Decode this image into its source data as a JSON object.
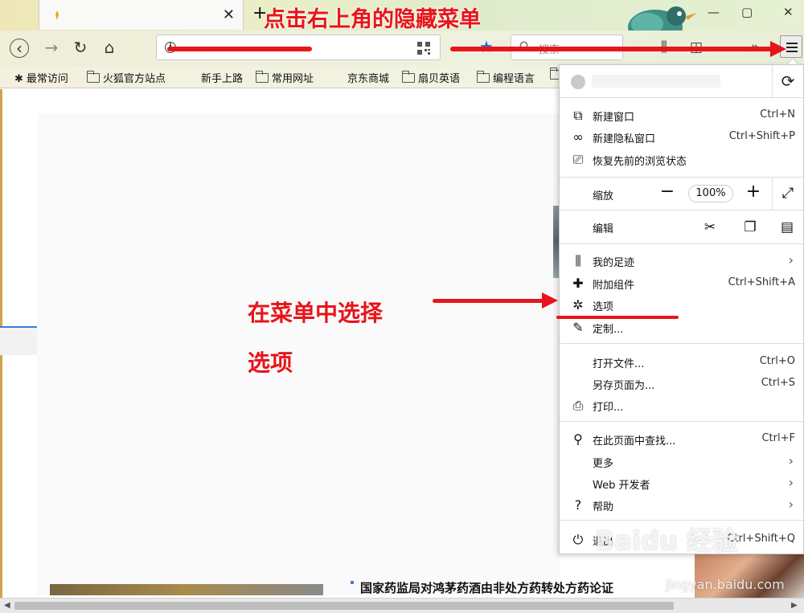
{
  "bookmarks": [
    {
      "label": "最常访问",
      "icon": "star-icon"
    },
    {
      "label": "火狐官方站点",
      "icon": "folder-icon"
    },
    {
      "label": "新手上路",
      "icon": "folder-icon"
    },
    {
      "label": "常用网址",
      "icon": "folder-icon"
    },
    {
      "label": "京东商城",
      "icon": "folder-icon"
    },
    {
      "label": "扇贝英语",
      "icon": "folder-icon"
    },
    {
      "label": "编程语言",
      "icon": "folder-icon"
    }
  ],
  "search": {
    "placeholder": "搜索"
  },
  "menu": {
    "new_window": {
      "label": "新建窗口",
      "shortcut": "Ctrl+N"
    },
    "private_window": {
      "label": "新建隐私窗口",
      "shortcut": "Ctrl+Shift+P"
    },
    "restore_session": {
      "label": "恢复先前的浏览状态"
    },
    "zoom": {
      "label": "缩放",
      "value": "100%"
    },
    "edit": {
      "label": "编辑"
    },
    "library": {
      "label": "我的足迹"
    },
    "addons": {
      "label": "附加组件",
      "shortcut": "Ctrl+Shift+A"
    },
    "options": {
      "label": "选项"
    },
    "customize": {
      "label": "定制..."
    },
    "open_file": {
      "label": "打开文件...",
      "shortcut": "Ctrl+O"
    },
    "save_page": {
      "label": "另存页面为...",
      "shortcut": "Ctrl+S"
    },
    "print": {
      "label": "打印..."
    },
    "find": {
      "label": "在此页面中查找...",
      "shortcut": "Ctrl+F"
    },
    "more": {
      "label": "更多"
    },
    "web_dev": {
      "label": "Web 开发者"
    },
    "help": {
      "label": "帮助"
    },
    "quit": {
      "label": "退出",
      "shortcut": "Ctrl+Shift+Q"
    }
  },
  "page": {
    "headline": "国家药监局对鸿茅药酒由非处方药转处方药论证"
  },
  "annotations": {
    "top": "点击右上角的隐藏菜单",
    "middle_line1": "在菜单中选择",
    "middle_line2": "选项"
  },
  "watermark": {
    "main": "Baidu 经验",
    "sub": "jingyan.baidu.com"
  },
  "colors": {
    "annotation_red": "#e8141a",
    "bookmark_star_blue": "#1e6fd8"
  }
}
